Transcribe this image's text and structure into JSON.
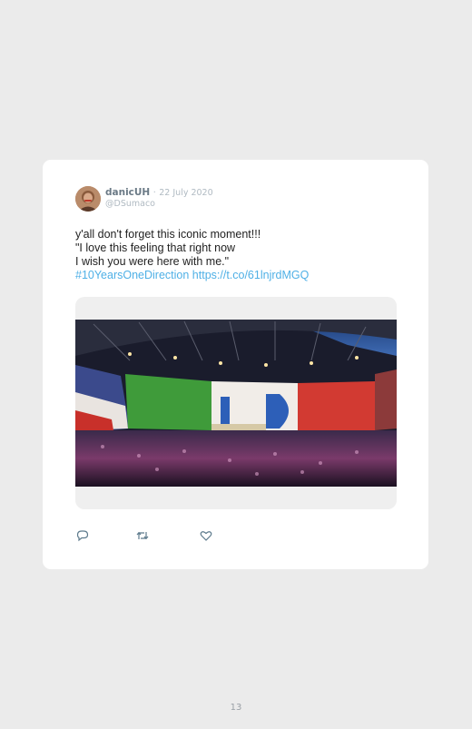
{
  "tweet": {
    "author_name": "danicUH",
    "separator": "·",
    "date": "22 July 2020",
    "handle": "@DSumaco",
    "lines": [
      "y'all don't forget this iconic moment!!!",
      "\"I love this feeling that right now",
      "I wish you were here with me.\""
    ],
    "hashtag": "#10YearsOneDirection",
    "link": "https://t.co/61lnjrdMGQ",
    "avatar_icon": "user-avatar-photo",
    "media_description_icon": "stadium-concert-photo"
  },
  "actions": {
    "reply_icon": "reply-icon",
    "retweet_icon": "retweet-icon",
    "like_icon": "heart-icon"
  },
  "page": {
    "number": "13"
  }
}
